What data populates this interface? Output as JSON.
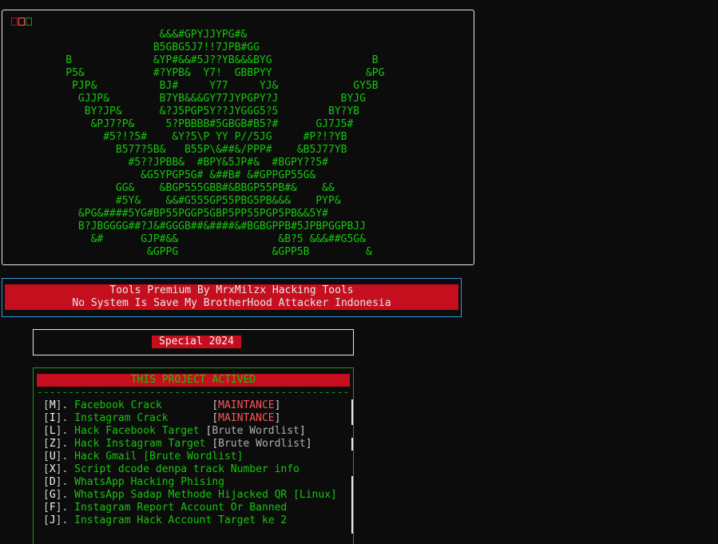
{
  "banner": {
    "ascii_art": "                         &&&#GPYJJYPG#&\n                        B5GBG5J7!!7JPB#GG\n          B             &YP#&&#5J??YB&&&BYG                B\n          P5&           #?YPB&  Y7!  GBBPYY               &PG\n           PJP&          BJ#     Y77     YJ&            GY5B\n            GJJP&        B7YB&&&GY77JYPGPY?J          BYJG\n             BY?JP&      &?J5PGP5Y??JYGGG5?5        BY?YB\n              &PJ7?P&     5?PBBBB#5GBGB#B5?#      GJ7J5#\n                #5?!?5#    &Y?5\\P YY P//5JG     #P?!?YB\n                  B577?5B&   B55P\\&##&/PPP#    &B5J77YB\n                    #5??JPBB&  #BPY&5JP#&  #BGPY??5#\n                      &G5YPGP5G# &##B# &#GPPGP55G&\n                  GG&    &BGP555GBB#&BBGP55PB#&    &&\n                  #5Y&    &&#G555GP55PBG5PB&&&    PYP&\n            &PG&####5YG#BP55PGGP5GBP5PP55PGP5PB&&5Y#\n            B?JBGGGG##?J&#GGGB##&####&#BGBGPPB#5JPBPGGPBJJ\n              &#      GJP#&&                &B?5 &&&##G5G&\n                       &GPPG               &GPP5B         &"
  },
  "title": {
    "line1": "Tools Premium By MrxMilzx Hacking Tools",
    "line2": "No System Is Save My BrotherHood Attacker Indonesia"
  },
  "special": {
    "label": "Special 2024"
  },
  "menu": {
    "header": "THIS PROJECT ACTIVED",
    "divider": "--------------------------------------------------",
    "items": [
      {
        "key": "M",
        "label": "Facebook Crack        ",
        "tag": "MAINTANCE",
        "tag_type": "status"
      },
      {
        "key": "I",
        "label": "Instagram Crack       ",
        "tag": "MAINTANCE",
        "tag_type": "status"
      },
      {
        "key": "L",
        "label": "Hack Facebook Target ",
        "tag": "Brute Wordlist",
        "tag_type": "plain"
      },
      {
        "key": "Z",
        "label": "Hack Instagram Target ",
        "tag": "Brute Wordlist",
        "tag_type": "plain"
      },
      {
        "key": "U",
        "label": "Hack Gmail [Brute Wordlist]",
        "tag": "",
        "tag_type": "none"
      },
      {
        "key": "X",
        "label": "Script dcode denpa track Number info",
        "tag": "",
        "tag_type": "none"
      },
      {
        "key": "D",
        "label": "WhatsApp Hacking Phising",
        "tag": "",
        "tag_type": "none"
      },
      {
        "key": "G",
        "label": "WhatsApp Sadap Methode Hijacked QR [Linux]",
        "tag": "",
        "tag_type": "none"
      },
      {
        "key": "F",
        "label": "Instagram Report Account Or Banned",
        "tag": "",
        "tag_type": "none"
      },
      {
        "key": "J",
        "label": "Instagram Hack Account Target ke 2",
        "tag": "",
        "tag_type": "none"
      }
    ]
  },
  "colors": {
    "background": "#0c0c0c",
    "green": "#16c60c",
    "red": "#c50f1f",
    "cyan_border": "#3a96dd"
  }
}
